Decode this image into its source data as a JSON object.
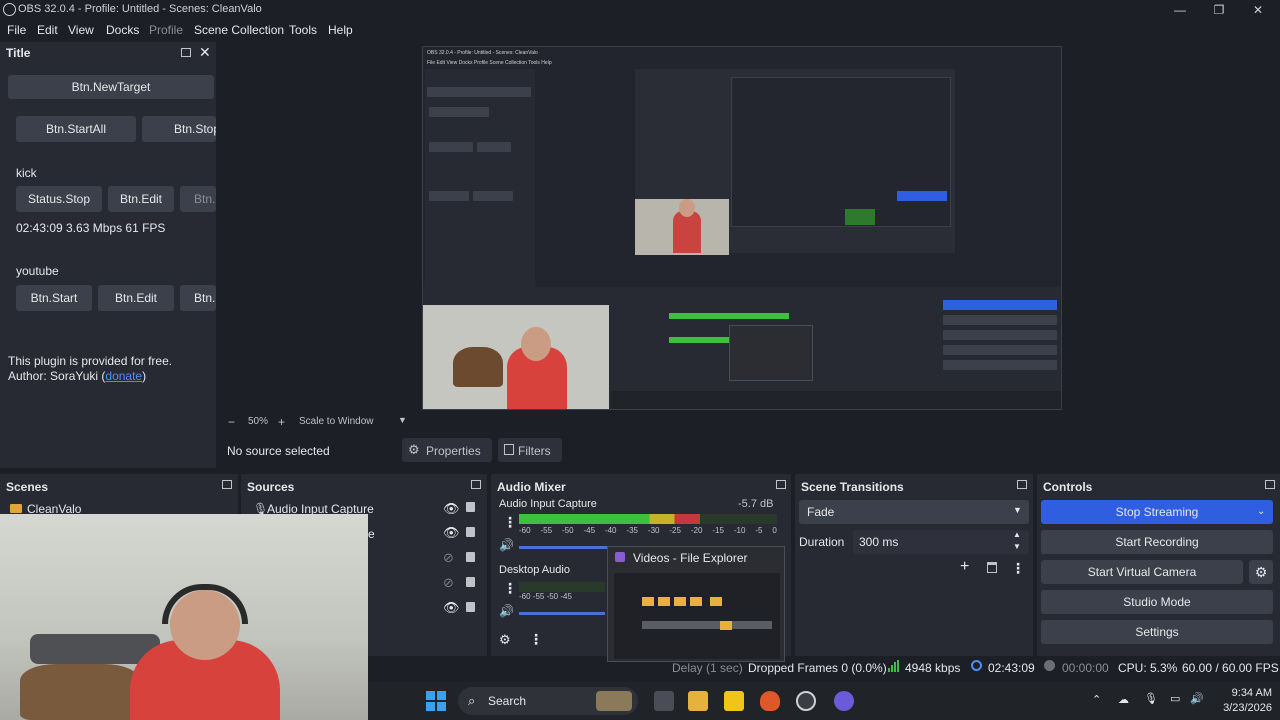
{
  "window": {
    "title": "OBS 32.0.4 - Profile: Untitled - Scenes: CleanValo"
  },
  "menu": [
    "File",
    "Edit",
    "View",
    "Docks",
    "Profile",
    "Scene Collection",
    "Tools",
    "Help"
  ],
  "title_dock": {
    "heading": "Title",
    "btn_new_target": "Btn.NewTarget",
    "btn_start_all": "Btn.StartAll",
    "btn_stop": "Btn.Stop",
    "kick_label": "kick",
    "kick_status": "Status.Stop",
    "kick_edit": "Btn.Edit",
    "kick_extra": "Btn.",
    "kick_stats": "02:43:09  3.63 Mbps  61 FPS",
    "youtube_label": "youtube",
    "yt_start": "Btn.Start",
    "yt_edit": "Btn.Edit",
    "yt_extra": "Btn.",
    "footer_line1": "This plugin is provided for free.",
    "footer_author": "Author: SoraYuki (",
    "footer_donate": "donate",
    "footer_close": ")"
  },
  "zoom": {
    "minus": "−",
    "value": "50%",
    "plus": "+",
    "mode": "Scale to Window"
  },
  "source_bar": {
    "no_source": "No source selected",
    "properties": "Properties",
    "filters": "Filters"
  },
  "scenes": {
    "heading": "Scenes",
    "items": [
      "CleanValo"
    ]
  },
  "sources": {
    "heading": "Sources",
    "items": [
      "Audio Input Capture",
      "e"
    ]
  },
  "audio_mixer": {
    "heading": "Audio Mixer",
    "channels": [
      {
        "name": "Audio Input Capture",
        "db": "-5.7 dB",
        "level": 0.7
      },
      {
        "name": "Desktop Audio",
        "db": "",
        "level": 0.0
      }
    ],
    "scale": [
      "-60",
      "-55",
      "-50",
      "-45",
      "-40",
      "-35",
      "-30",
      "-25",
      "-20",
      "-15",
      "-10",
      "-5",
      "0"
    ]
  },
  "scene_transitions": {
    "heading": "Scene Transitions",
    "transition": "Fade",
    "duration_label": "Duration",
    "duration_value": "300 ms"
  },
  "controls": {
    "heading": "Controls",
    "stop_streaming": "Stop Streaming",
    "start_recording": "Start Recording",
    "start_virtual_camera": "Start Virtual Camera",
    "studio_mode": "Studio Mode",
    "settings": "Settings"
  },
  "popup": {
    "title": "Videos - File Explorer"
  },
  "status": {
    "delay": "Delay (1 sec)",
    "dropped": "Dropped Frames 0 (0.0%)",
    "kbps": "4948 kbps",
    "stream_time": "02:43:09",
    "rec_time": "00:00:00",
    "cpu": "CPU: 5.3%",
    "fps": "60.00 / 60.00 FPS"
  },
  "taskbar": {
    "search": "Search",
    "time": "9:34 AM",
    "date": "3/23/2026"
  },
  "nested": {
    "title": "OBS 32.0.4 - Profile: Untitled - Scenes: CleanValo",
    "menu": "File   Edit   View   Docks   Profile   Scene Collection   Tools   Help"
  },
  "colors": {
    "accent": "#2f5fe0",
    "panel": "#272a33",
    "bg": "#1d1f26",
    "button": "#3c404b",
    "meter_green": "#3fbf3f",
    "meter_yellow": "#c8b12a",
    "meter_red": "#c43a3a"
  }
}
